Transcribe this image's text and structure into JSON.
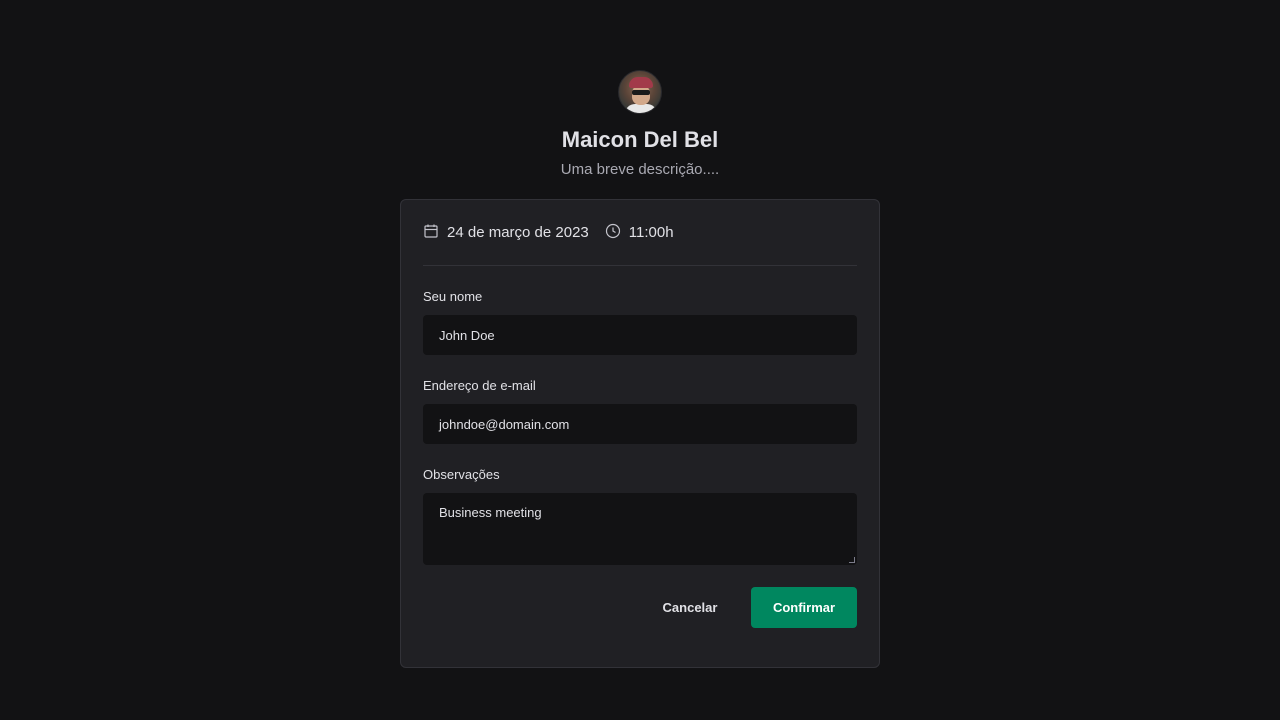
{
  "profile": {
    "name": "Maicon Del Bel",
    "bio": "Uma breve descrição...."
  },
  "schedule": {
    "date": "24 de março de 2023",
    "time": "11:00h",
    "date_icon": "calendar-icon",
    "time_icon": "clock-icon"
  },
  "form": {
    "name_label": "Seu nome",
    "name_value": "John Doe",
    "email_label": "Endereço de e-mail",
    "email_value": "johndoe@domain.com",
    "notes_label": "Observações",
    "notes_value": "Business meeting"
  },
  "actions": {
    "cancel_label": "Cancelar",
    "confirm_label": "Confirmar"
  },
  "colors": {
    "background": "#121214",
    "card": "#202024",
    "accent": "#00875f"
  }
}
